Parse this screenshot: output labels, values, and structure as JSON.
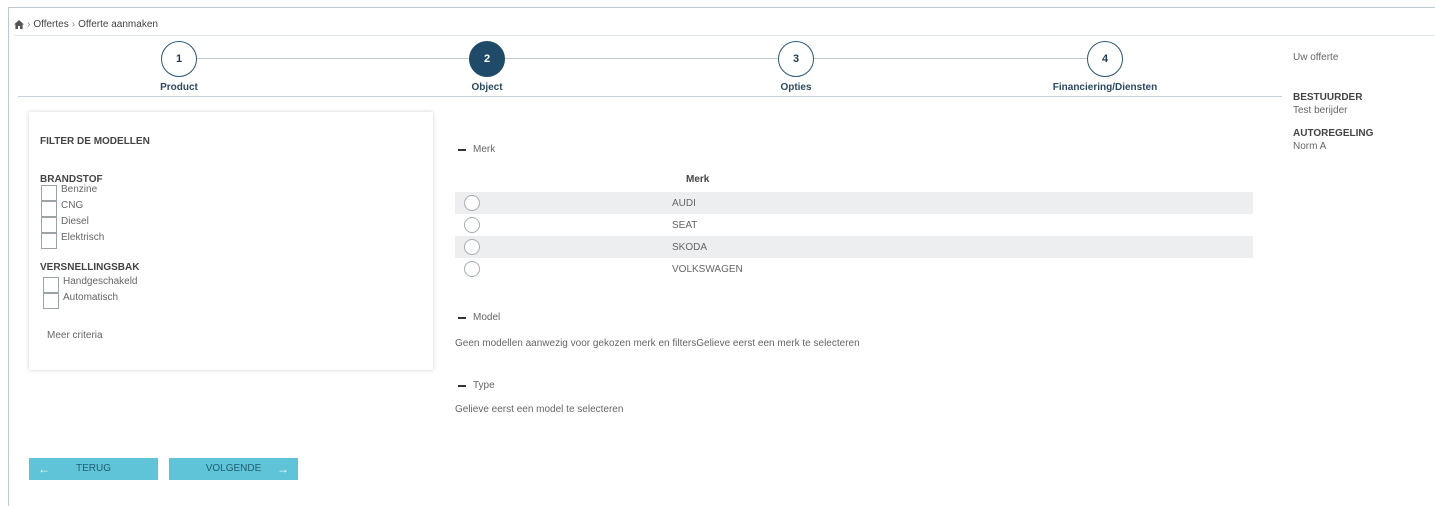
{
  "breadcrumb": {
    "home_icon": "home-icon",
    "items": [
      "Offertes",
      "Offerte aanmaken"
    ]
  },
  "stepper": {
    "steps": [
      {
        "number": "1",
        "label": "Product",
        "active": false
      },
      {
        "number": "2",
        "label": "Object",
        "active": true
      },
      {
        "number": "3",
        "label": "Opties",
        "active": false
      },
      {
        "number": "4",
        "label": "Financiering/Diensten",
        "active": false
      }
    ],
    "active_color": "#1f4b69"
  },
  "summary": {
    "title": "Uw offerte",
    "driver_label": "BESTUURDER",
    "driver_value": "Test berijder",
    "rule_label": "AUTOREGELING",
    "rule_value": "Norm A"
  },
  "filter": {
    "title": "FILTER DE MODELLEN",
    "fuel_label": "BRANDSTOF",
    "fuel_options": [
      "Benzine",
      "CNG",
      "Diesel",
      "Elektrisch"
    ],
    "gearbox_label": "VERSNELLINGSBAK",
    "gearbox_options": [
      "Handgeschakeld",
      "Automatisch"
    ],
    "more_criteria": "Meer criteria"
  },
  "main": {
    "merk_section": "Merk",
    "merk_column": "Merk",
    "brands": [
      "AUDI",
      "SEAT",
      "SKODA",
      "VOLKSWAGEN"
    ],
    "model_section": "Model",
    "model_message": "Geen modellen aanwezig voor gekozen merk en filtersGelieve eerst een merk te selecteren",
    "type_section": "Type",
    "type_message": "Gelieve eerst een model te selecteren"
  },
  "buttons": {
    "back": "TERUG",
    "next": "VOLGENDE",
    "color": "#5fc4d8"
  }
}
